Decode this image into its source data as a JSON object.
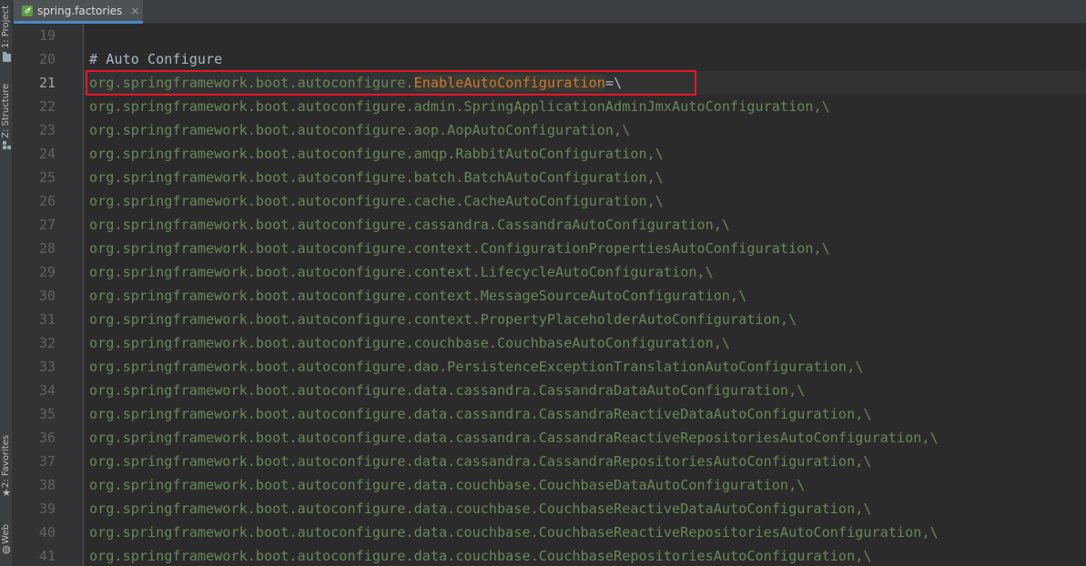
{
  "side_tabs": {
    "project": "1: Project",
    "structure": "Z: Structure",
    "favorites": "2: Favorites",
    "web": "Web"
  },
  "editor_tab": {
    "file_name": "spring.factories",
    "close_glyph": "×"
  },
  "lines": [
    {
      "num": "19",
      "text": ""
    },
    {
      "num": "20",
      "text": "# Auto Configure"
    },
    {
      "num": "21",
      "prefix": "org.springframework.boot.autoconfigure.",
      "highlight": "EnableAutoConfiguration",
      "suffix": "=\\"
    },
    {
      "num": "22",
      "text": "org.springframework.boot.autoconfigure.admin.SpringApplicationAdminJmxAutoConfiguration,\\"
    },
    {
      "num": "23",
      "text": "org.springframework.boot.autoconfigure.aop.AopAutoConfiguration,\\"
    },
    {
      "num": "24",
      "text": "org.springframework.boot.autoconfigure.amqp.RabbitAutoConfiguration,\\"
    },
    {
      "num": "25",
      "text": "org.springframework.boot.autoconfigure.batch.BatchAutoConfiguration,\\"
    },
    {
      "num": "26",
      "text": "org.springframework.boot.autoconfigure.cache.CacheAutoConfiguration,\\"
    },
    {
      "num": "27",
      "text": "org.springframework.boot.autoconfigure.cassandra.CassandraAutoConfiguration,\\"
    },
    {
      "num": "28",
      "text": "org.springframework.boot.autoconfigure.context.ConfigurationPropertiesAutoConfiguration,\\"
    },
    {
      "num": "29",
      "text": "org.springframework.boot.autoconfigure.context.LifecycleAutoConfiguration,\\"
    },
    {
      "num": "30",
      "text": "org.springframework.boot.autoconfigure.context.MessageSourceAutoConfiguration,\\"
    },
    {
      "num": "31",
      "text": "org.springframework.boot.autoconfigure.context.PropertyPlaceholderAutoConfiguration,\\"
    },
    {
      "num": "32",
      "text": "org.springframework.boot.autoconfigure.couchbase.CouchbaseAutoConfiguration,\\"
    },
    {
      "num": "33",
      "text": "org.springframework.boot.autoconfigure.dao.PersistenceExceptionTranslationAutoConfiguration,\\"
    },
    {
      "num": "34",
      "text": "org.springframework.boot.autoconfigure.data.cassandra.CassandraDataAutoConfiguration,\\"
    },
    {
      "num": "35",
      "text": "org.springframework.boot.autoconfigure.data.cassandra.CassandraReactiveDataAutoConfiguration,\\"
    },
    {
      "num": "36",
      "text": "org.springframework.boot.autoconfigure.data.cassandra.CassandraReactiveRepositoriesAutoConfiguration,\\"
    },
    {
      "num": "37",
      "text": "org.springframework.boot.autoconfigure.data.cassandra.CassandraRepositoriesAutoConfiguration,\\"
    },
    {
      "num": "38",
      "text": "org.springframework.boot.autoconfigure.data.couchbase.CouchbaseDataAutoConfiguration,\\"
    },
    {
      "num": "39",
      "text": "org.springframework.boot.autoconfigure.data.couchbase.CouchbaseReactiveDataAutoConfiguration,\\"
    },
    {
      "num": "40",
      "text": "org.springframework.boot.autoconfigure.data.couchbase.CouchbaseReactiveRepositoriesAutoConfiguration,\\"
    },
    {
      "num": "41",
      "text": "org.springframework.boot.autoconfigure.data.couchbase.CouchbaseRepositoriesAutoConfiguration,\\"
    }
  ],
  "colors": {
    "property_value": "#6a8759",
    "comment": "#a9b7c6",
    "highlighted_class": "#cc7832",
    "annotation_box": "#e8162a"
  }
}
